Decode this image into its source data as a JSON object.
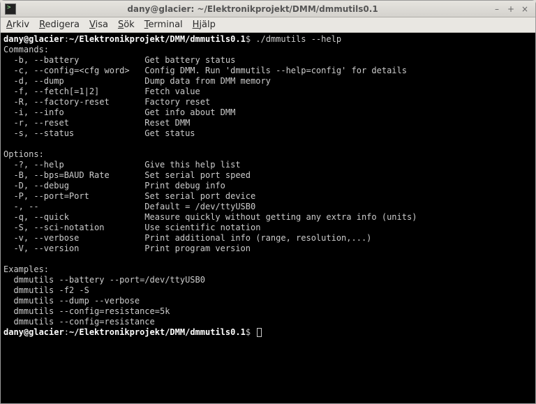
{
  "window": {
    "title": "dany@glacier: ~/Elektronikprojekt/DMM/dmmutils0.1"
  },
  "menubar": {
    "items": [
      {
        "html": "<u>A</u>rkiv"
      },
      {
        "html": "<u>R</u>edigera"
      },
      {
        "html": "<u>V</u>isa"
      },
      {
        "html": "<u>S</u>ök"
      },
      {
        "html": "<u>T</u>erminal"
      },
      {
        "html": "<u>H</u>jälp"
      }
    ]
  },
  "prompt1": {
    "userhost": "dany@glacier",
    "colon": ":",
    "path": "~/Elektronikprojekt/DMM/dmmutils0.1",
    "dollar": "$",
    "cmd": " ./dmmutils --help"
  },
  "headers": {
    "commands": "Commands:",
    "options": "Options:",
    "examples": "Examples:"
  },
  "commands": [
    {
      "flag": "  -b, --battery             ",
      "desc": "Get battery status"
    },
    {
      "flag": "  -c, --config=<cfg word>   ",
      "desc": "Config DMM. Run 'dmmutils --help=config' for details"
    },
    {
      "flag": "  -d, --dump                ",
      "desc": "Dump data from DMM memory"
    },
    {
      "flag": "  -f, --fetch[=1|2]         ",
      "desc": "Fetch value"
    },
    {
      "flag": "  -R, --factory-reset       ",
      "desc": "Factory reset"
    },
    {
      "flag": "  -i, --info                ",
      "desc": "Get info about DMM"
    },
    {
      "flag": "  -r, --reset               ",
      "desc": "Reset DMM"
    },
    {
      "flag": "  -s, --status              ",
      "desc": "Get status"
    }
  ],
  "options": [
    {
      "flag": "  -?, --help                ",
      "desc": "Give this help list"
    },
    {
      "flag": "  -B, --bps=BAUD Rate       ",
      "desc": "Set serial port speed"
    },
    {
      "flag": "  -D, --debug               ",
      "desc": "Print debug info"
    },
    {
      "flag": "  -P, --port=Port           ",
      "desc": "Set serial port device"
    },
    {
      "flag": "  -, --                     ",
      "desc": "Default = /dev/ttyUSB0"
    },
    {
      "flag": "  -q, --quick               ",
      "desc": "Measure quickly without getting any extra info (units)"
    },
    {
      "flag": "  -S, --sci-notation        ",
      "desc": "Use scientific notation"
    },
    {
      "flag": "  -v, --verbose             ",
      "desc": "Print additional info (range, resolution,...)"
    },
    {
      "flag": "  -V, --version             ",
      "desc": "Print program version"
    }
  ],
  "examples": [
    "  dmmutils --battery --port=/dev/ttyUSB0",
    "  dmmutils -f2 -S",
    "  dmmutils --dump --verbose",
    "  dmmutils --config=resistance=5k",
    "  dmmutils --config=resistance"
  ],
  "prompt2": {
    "userhost": "dany@glacier",
    "colon": ":",
    "path": "~/Elektronikprojekt/DMM/dmmutils0.1",
    "dollar": "$"
  }
}
